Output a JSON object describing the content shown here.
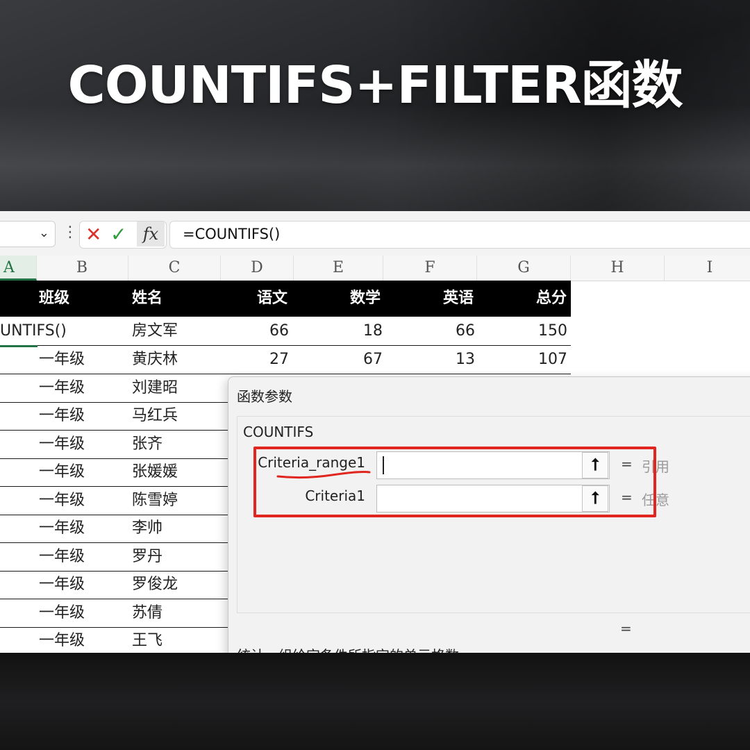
{
  "banner": {
    "title": "COUNTIFS+FILTER函数"
  },
  "formula_bar": {
    "cancel_icon": "x-icon",
    "enter_icon": "check-icon",
    "fx_label": "fx",
    "formula": "=COUNTIFS()"
  },
  "columns": [
    "A",
    "B",
    "C",
    "D",
    "E",
    "F",
    "G",
    "H",
    "I"
  ],
  "table": {
    "headers": [
      "班级",
      "姓名",
      "语文",
      "数学",
      "英语",
      "总分"
    ],
    "rows": [
      {
        "a": "UNTIFS()",
        "name": "房文军",
        "chinese": "66",
        "math": "18",
        "english": "66",
        "total": "150"
      },
      {
        "class": "一年级",
        "name": "黄庆林",
        "chinese": "27",
        "math": "67",
        "english": "13",
        "total": "107"
      },
      {
        "class": "一年级",
        "name": "刘建昭"
      },
      {
        "class": "一年级",
        "name": "马红兵"
      },
      {
        "class": "一年级",
        "name": "张齐"
      },
      {
        "class": "一年级",
        "name": "张媛媛"
      },
      {
        "class": "一年级",
        "name": "陈雪婷"
      },
      {
        "class": "一年级",
        "name": "李帅"
      },
      {
        "class": "一年级",
        "name": "罗丹"
      },
      {
        "class": "一年级",
        "name": "罗俊龙"
      },
      {
        "class": "一年级",
        "name": "苏倩"
      },
      {
        "class": "一年级",
        "name": "王飞"
      }
    ]
  },
  "dialog": {
    "title": "函数参数",
    "function_name": "COUNTIFS",
    "args": [
      {
        "label": "Criteria_range1",
        "eq": "=",
        "hint": "引用"
      },
      {
        "label": "Criteria1",
        "eq": "=",
        "hint": "任意"
      }
    ],
    "result_eq": "=",
    "description": "统计一组给定条件所指定的单元格数",
    "upload_icon": "collapse-arrow-icon"
  },
  "colors": {
    "accent_green": "#217346",
    "highlight_red": "#e0261e"
  }
}
